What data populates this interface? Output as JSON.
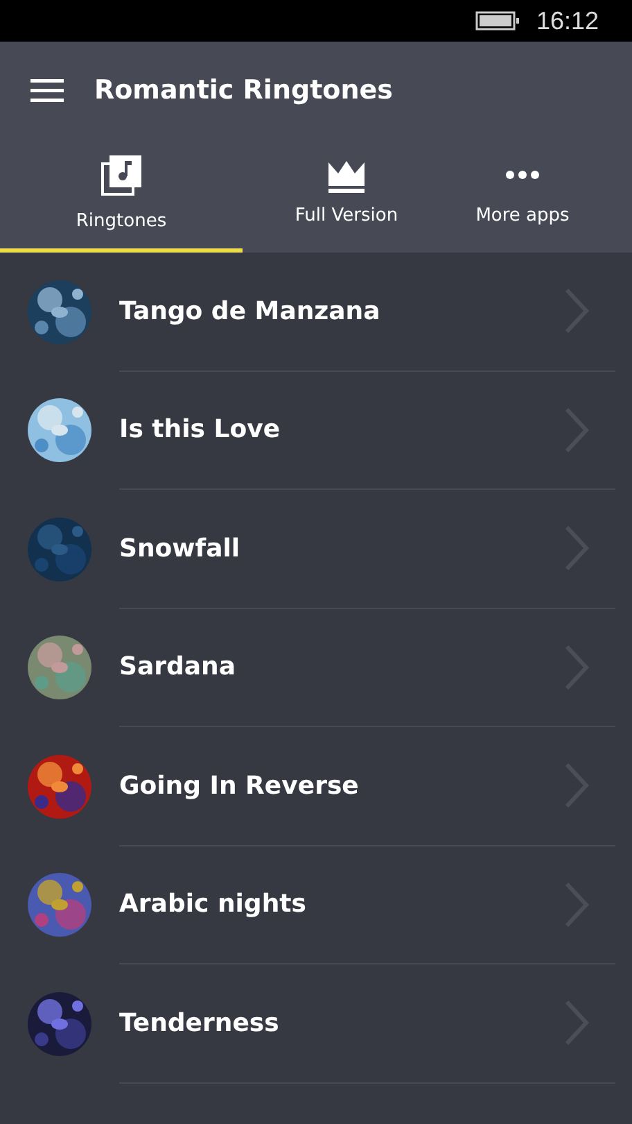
{
  "status_bar": {
    "time": "16:12"
  },
  "header": {
    "title": "Romantic Ringtones"
  },
  "tabs": [
    {
      "label": "Ringtones",
      "kind": "music",
      "selected": true
    },
    {
      "label": "Full Version",
      "kind": "crown",
      "selected": false
    },
    {
      "label": "More apps",
      "kind": "more",
      "selected": false
    }
  ],
  "ringtones": [
    {
      "title": "Tango de Manzana",
      "kind": "picture"
    },
    {
      "title": "Is this Love",
      "kind": "picture"
    },
    {
      "title": "Snowfall",
      "kind": "picture"
    },
    {
      "title": "Sardana",
      "kind": "picture"
    },
    {
      "title": "Going In Reverse",
      "kind": "picture"
    },
    {
      "title": "Arabic nights",
      "kind": "picture"
    },
    {
      "title": "Tenderness",
      "kind": "picture"
    }
  ]
}
